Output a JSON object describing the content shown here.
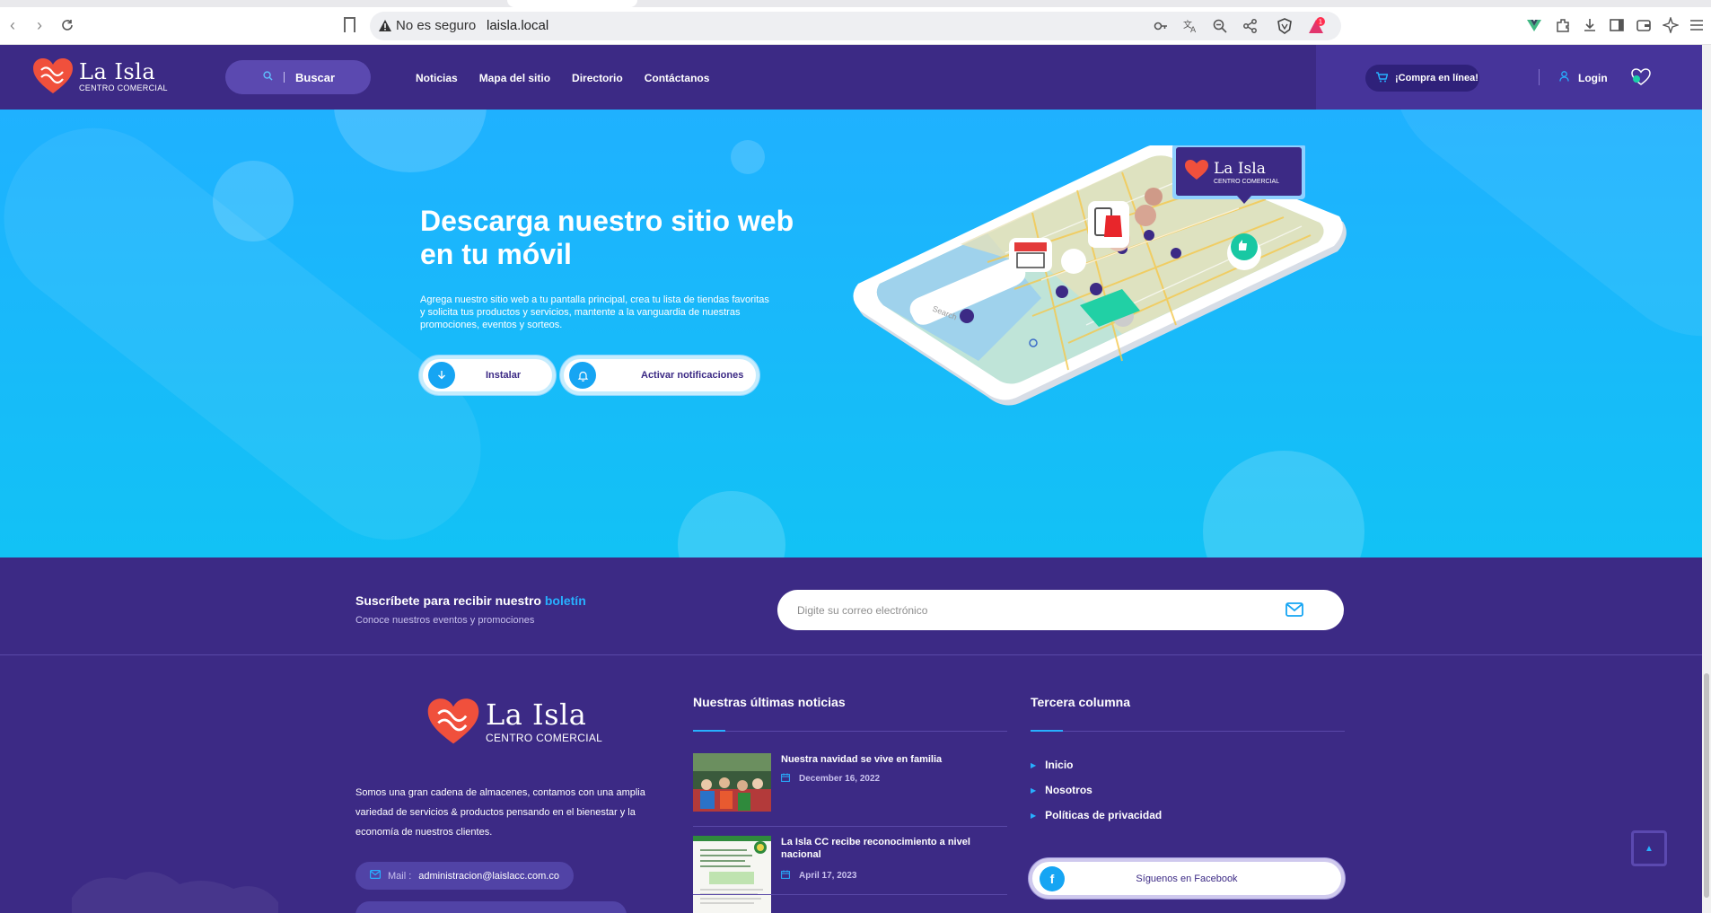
{
  "browser": {
    "security_label": "No es seguro",
    "url": "laisla.local",
    "notification_count": "1"
  },
  "header": {
    "logo": {
      "name": "La Isla",
      "sub": "CENTRO COMERCIAL"
    },
    "search_label": "Buscar",
    "nav": [
      "Noticias",
      "Mapa del sitio",
      "Directorio",
      "Contáctanos"
    ],
    "buy_label": "¡Compra en línea!",
    "login_label": "Login"
  },
  "hero": {
    "title": "Descarga nuestro sitio web en tu móvil",
    "description": "Agrega nuestro sitio web a tu pantalla principal, crea tu lista de tiendas favoritas y solicita tus productos y servicios, mantente a la vanguardia de nuestras promociones, eventos y sorteos.",
    "install_label": "Instalar",
    "notify_label": "Activar notificaciones",
    "phone": {
      "search_placeholder": "Search",
      "logo_name": "La Isla",
      "logo_sub": "CENTRO COMERCIAL"
    }
  },
  "newsletter": {
    "title_main": "Suscríbete para recibir nuestro",
    "title_highlight": "boletín",
    "subtitle": "Conoce nuestros eventos y promociones",
    "email_placeholder": "Digite su correo electrónico"
  },
  "footer": {
    "logo": {
      "name": "La Isla",
      "sub": "CENTRO COMERCIAL"
    },
    "about": "Somos una gran cadena de almacenes, contamos con una amplia variedad de servicios & productos pensando en el bienestar y la economía de nuestros clientes.",
    "mail_label": "Mail :",
    "mail_value": "administracion@laislacc.com.co",
    "news_heading": "Nuestras últimas noticias",
    "news": [
      {
        "title": "Nuestra navidad se vive en familia",
        "date": "December 16, 2022"
      },
      {
        "title": "La Isla CC recibe reconocimiento a nivel nacional",
        "date": "April 17, 2023"
      }
    ],
    "third_heading": "Tercera columna",
    "links": [
      "Inicio",
      "Nosotros",
      "Políticas de privacidad"
    ],
    "facebook_label": "Síguenos en Facebook"
  },
  "colors": {
    "brand_purple": "#3c2a85",
    "accent_blue": "#27b0ff",
    "hero_blue": "#1fb1ff",
    "logo_red": "#f0503c"
  }
}
